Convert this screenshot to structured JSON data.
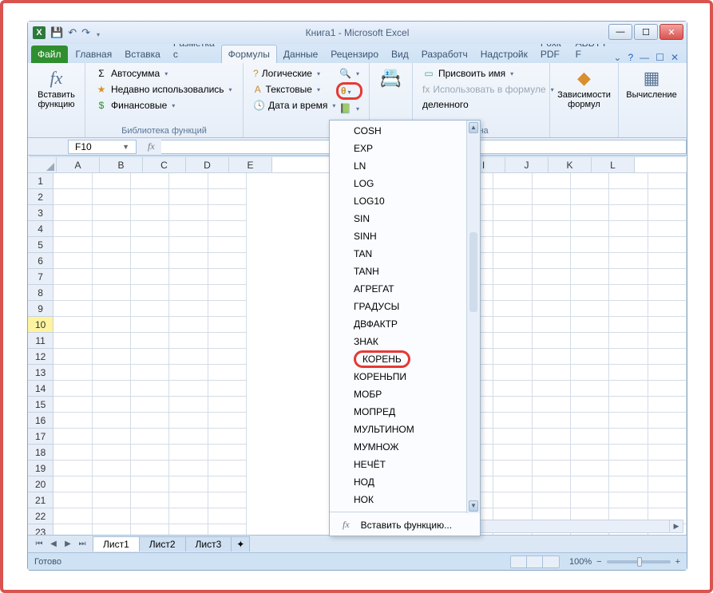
{
  "window": {
    "title": "Книга1 - Microsoft Excel"
  },
  "tabs": {
    "file": "Файл",
    "items": [
      "Главная",
      "Вставка",
      "Разметка с",
      "Формулы",
      "Данные",
      "Рецензиро",
      "Вид",
      "Разработч",
      "Надстройк",
      "Foxit PDF",
      "ABBYY F"
    ],
    "active_index": 3
  },
  "ribbon": {
    "insert_fn": {
      "label": "Вставить функцию"
    },
    "lib": {
      "autosum": "Автосумма",
      "recent": "Недавно использовались",
      "financial": "Финансовые",
      "logical": "Логические",
      "text": "Текстовые",
      "datetime": "Дата и время",
      "group_label": "Библиотека функций"
    },
    "names": {
      "assign": "Присвоить имя",
      "use_in_formula": "Использовать в формуле",
      "from_selection": "деленного",
      "group_label": "ена"
    },
    "deps": {
      "label": "Зависимости формул"
    },
    "calc": {
      "label": "Вычисление"
    }
  },
  "namebox": "F10",
  "columns": [
    "A",
    "B",
    "C",
    "D",
    "E",
    "I",
    "J",
    "K",
    "L"
  ],
  "rows": [
    1,
    2,
    3,
    4,
    5,
    6,
    7,
    8,
    9,
    10,
    11,
    12,
    13,
    14,
    15,
    16,
    17,
    18,
    19,
    20,
    21,
    22,
    23
  ],
  "selected_row": 10,
  "menu": {
    "items": [
      "COSH",
      "EXP",
      "LN",
      "LOG",
      "LOG10",
      "SIN",
      "SINH",
      "TAN",
      "TANH",
      "АГРЕГАТ",
      "ГРАДУСЫ",
      "ДВФАКТР",
      "ЗНАК",
      "КОРЕНЬ",
      "КОРЕНЬПИ",
      "МОБР",
      "МОПРЕД",
      "МУЛЬТИНОМ",
      "МУМНОЖ",
      "НЕЧЁТ",
      "НОД",
      "НОК"
    ],
    "highlight_index": 13,
    "insert_fn": "Вставить функцию..."
  },
  "sheets": {
    "tabs": [
      "Лист1",
      "Лист2",
      "Лист3"
    ],
    "active_index": 0
  },
  "status": {
    "ready": "Готово",
    "zoom": "100%"
  }
}
